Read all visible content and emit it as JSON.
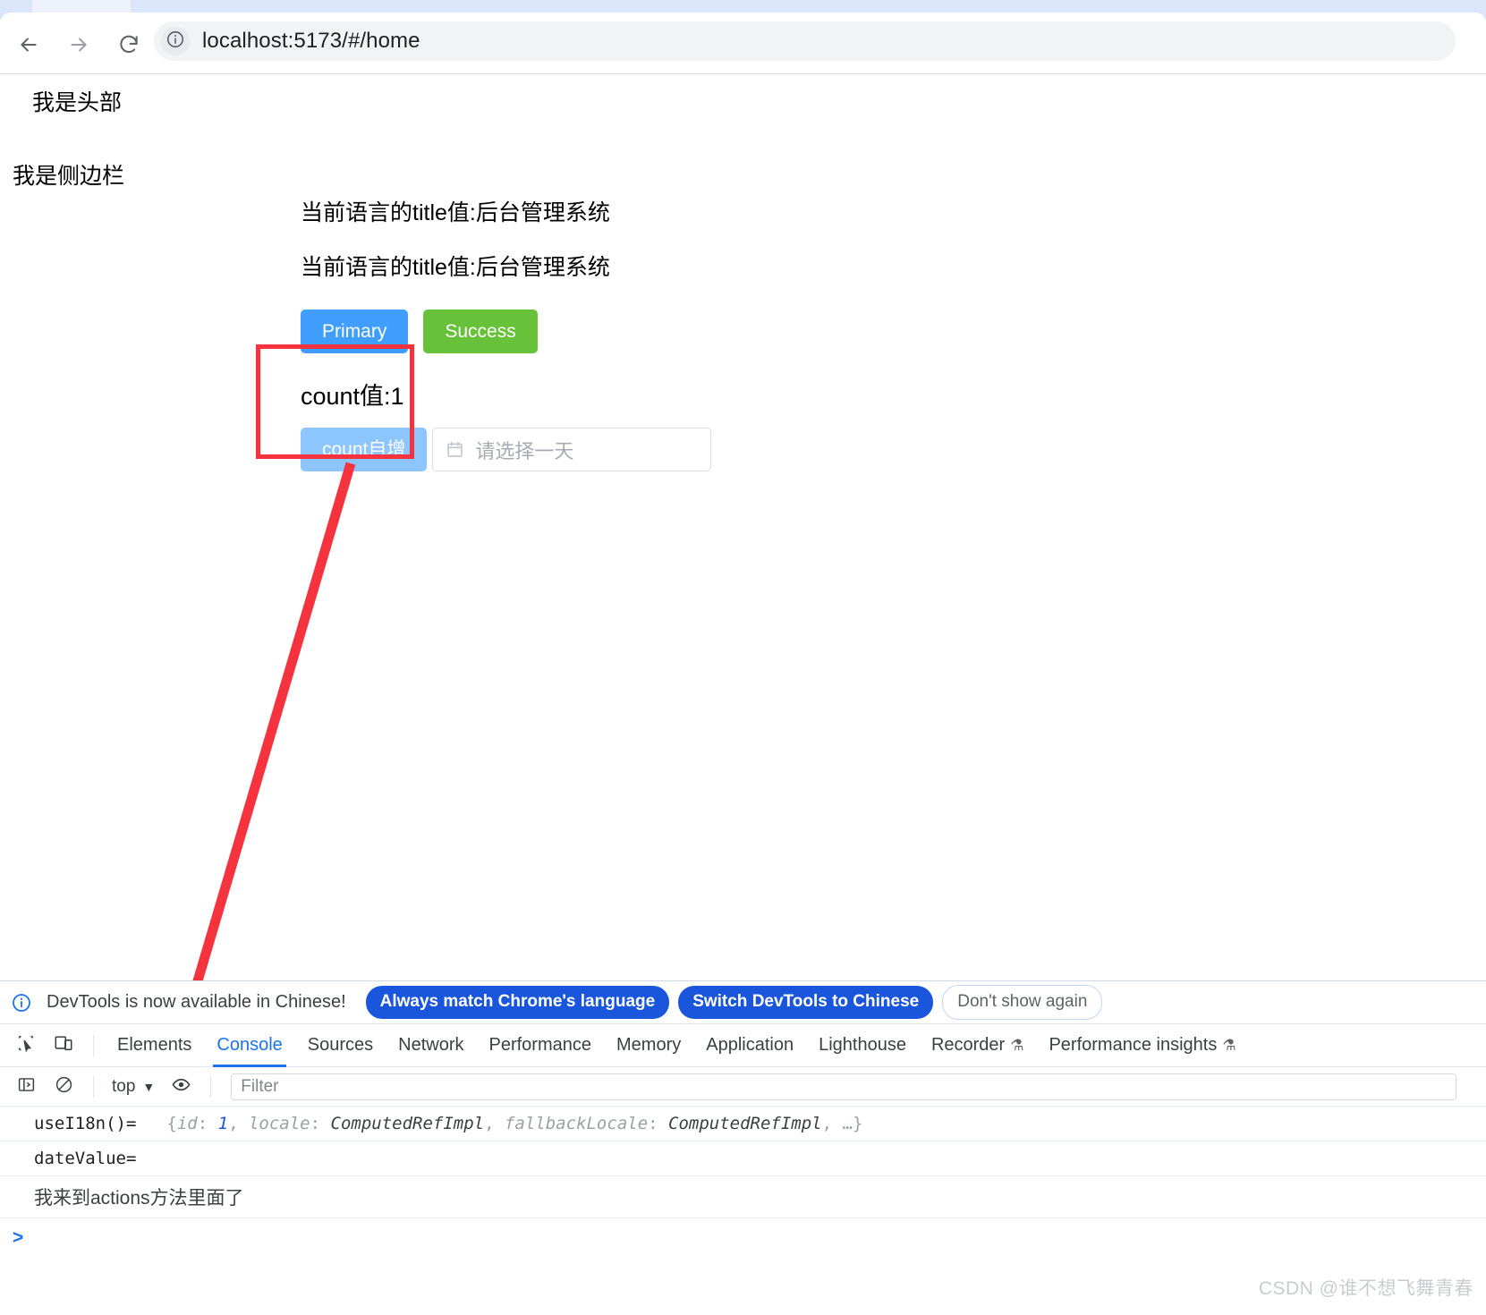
{
  "browser": {
    "back_icon": "back-arrow-icon",
    "forward_icon": "forward-arrow-icon",
    "reload_icon": "reload-icon",
    "site_info_icon": "info-circle-icon",
    "url": "localhost:5173/#/home"
  },
  "page": {
    "header_text": "我是头部",
    "sidebar_text": "我是侧边栏",
    "i18n_lines": [
      "当前语言的title值:后台管理系统",
      "当前语言的title值:后台管理系统"
    ],
    "buttons": {
      "primary_label": "Primary",
      "success_label": "Success",
      "count_increment_label": "count自增"
    },
    "count_label": "count值:1",
    "date_picker": {
      "icon": "calendar-icon",
      "placeholder": "请选择一天",
      "value": ""
    },
    "colors": {
      "primary": "#409EFF",
      "success": "#67C23A",
      "primary_light": "#8CC5FF",
      "annotation_red": "#F5333F"
    }
  },
  "devtools": {
    "banner": {
      "info_icon": "info-circle-icon",
      "message": "DevTools is now available in Chinese!",
      "always_match_label": "Always match Chrome's language",
      "switch_label": "Switch DevTools to Chinese",
      "dismiss_label": "Don't show again"
    },
    "toolbar_icons": {
      "inspect": "inspect-element-icon",
      "device": "device-toolbar-icon"
    },
    "tabs": [
      {
        "label": "Elements",
        "active": false,
        "flask": ""
      },
      {
        "label": "Console",
        "active": true,
        "flask": ""
      },
      {
        "label": "Sources",
        "active": false,
        "flask": ""
      },
      {
        "label": "Network",
        "active": false,
        "flask": ""
      },
      {
        "label": "Performance",
        "active": false,
        "flask": ""
      },
      {
        "label": "Memory",
        "active": false,
        "flask": ""
      },
      {
        "label": "Application",
        "active": false,
        "flask": ""
      },
      {
        "label": "Lighthouse",
        "active": false,
        "flask": ""
      },
      {
        "label": "Recorder",
        "active": false,
        "flask": "⚗"
      },
      {
        "label": "Performance insights",
        "active": false,
        "flask": "⚗"
      }
    ],
    "console_toolbar": {
      "sidebar_icon": "console-sidebar-icon",
      "clear_icon": "clear-console-icon",
      "context": "top",
      "chevron": "▼",
      "eye_icon": "live-expression-eye-icon",
      "filter_placeholder": "Filter"
    },
    "logs": [
      {
        "text": "useI18n()=",
        "object_prefix": "{",
        "object_parts": [
          {
            "key": "id",
            "value": "1",
            "type": "num"
          },
          {
            "key": "locale",
            "value": "ComputedRefImpl",
            "type": "cls"
          },
          {
            "key": "fallbackLocale",
            "value": "ComputedRefImpl",
            "type": "cls"
          }
        ],
        "object_suffix": ", …}"
      },
      {
        "text": "dateValue=",
        "object_prefix": "",
        "object_parts": [],
        "object_suffix": ""
      }
    ],
    "log_cn": "我来到actions方法里面了",
    "prompt": ">"
  },
  "watermark": "CSDN @谁不想飞舞青春"
}
